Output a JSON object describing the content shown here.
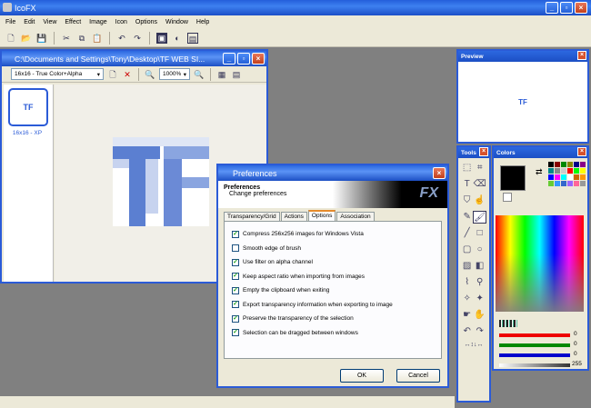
{
  "app": {
    "title": "IcoFX"
  },
  "menu": [
    "File",
    "Edit",
    "View",
    "Effect",
    "Image",
    "Icon",
    "Options",
    "Window",
    "Help"
  ],
  "toolbar_icons": [
    "new-icon",
    "open-icon",
    "save-icon",
    "cut-icon",
    "copy-icon",
    "paste-icon",
    "undo-icon",
    "redo-icon",
    "image-editor-icon",
    "effects-icon",
    "resource-icon"
  ],
  "document": {
    "title": "C:\\Documents and Settings\\Tony\\Desktop\\TF WEB SI...",
    "format": "16x16 - True Color+Alpha",
    "zoom": "1000%",
    "thumb_caption": "16x16 - XP",
    "thumb_text": "TF"
  },
  "preview": {
    "title": "Preview",
    "text": "TF"
  },
  "tools": {
    "title": "Tools"
  },
  "colors": {
    "title": "Colors",
    "red": "0",
    "green": "0",
    "blue": "0",
    "alpha": "255"
  },
  "dialog": {
    "title": "Preferences",
    "heading": "Preferences",
    "subheading": "Change preferences",
    "logo": "FX",
    "tabs": [
      "Transparency/Grid",
      "Actions",
      "Options",
      "Association"
    ],
    "active_tab": "Options",
    "options": [
      {
        "label": "Compress 256x256 images for Windows Vista",
        "checked": true
      },
      {
        "label": "Smooth edge of brush",
        "checked": false
      },
      {
        "label": "Use filter on alpha channel",
        "checked": true
      },
      {
        "label": "Keep aspect ratio when importing from images",
        "checked": true
      },
      {
        "label": "Empty the clipboard when exiting",
        "checked": true
      },
      {
        "label": "Export transparency information when exporting to image",
        "checked": true
      },
      {
        "label": "Preserve the transparency of the selection",
        "checked": true
      },
      {
        "label": "Selection can be dragged between windows",
        "checked": true
      }
    ],
    "ok": "OK",
    "cancel": "Cancel"
  },
  "accent": "#2b5bd7"
}
